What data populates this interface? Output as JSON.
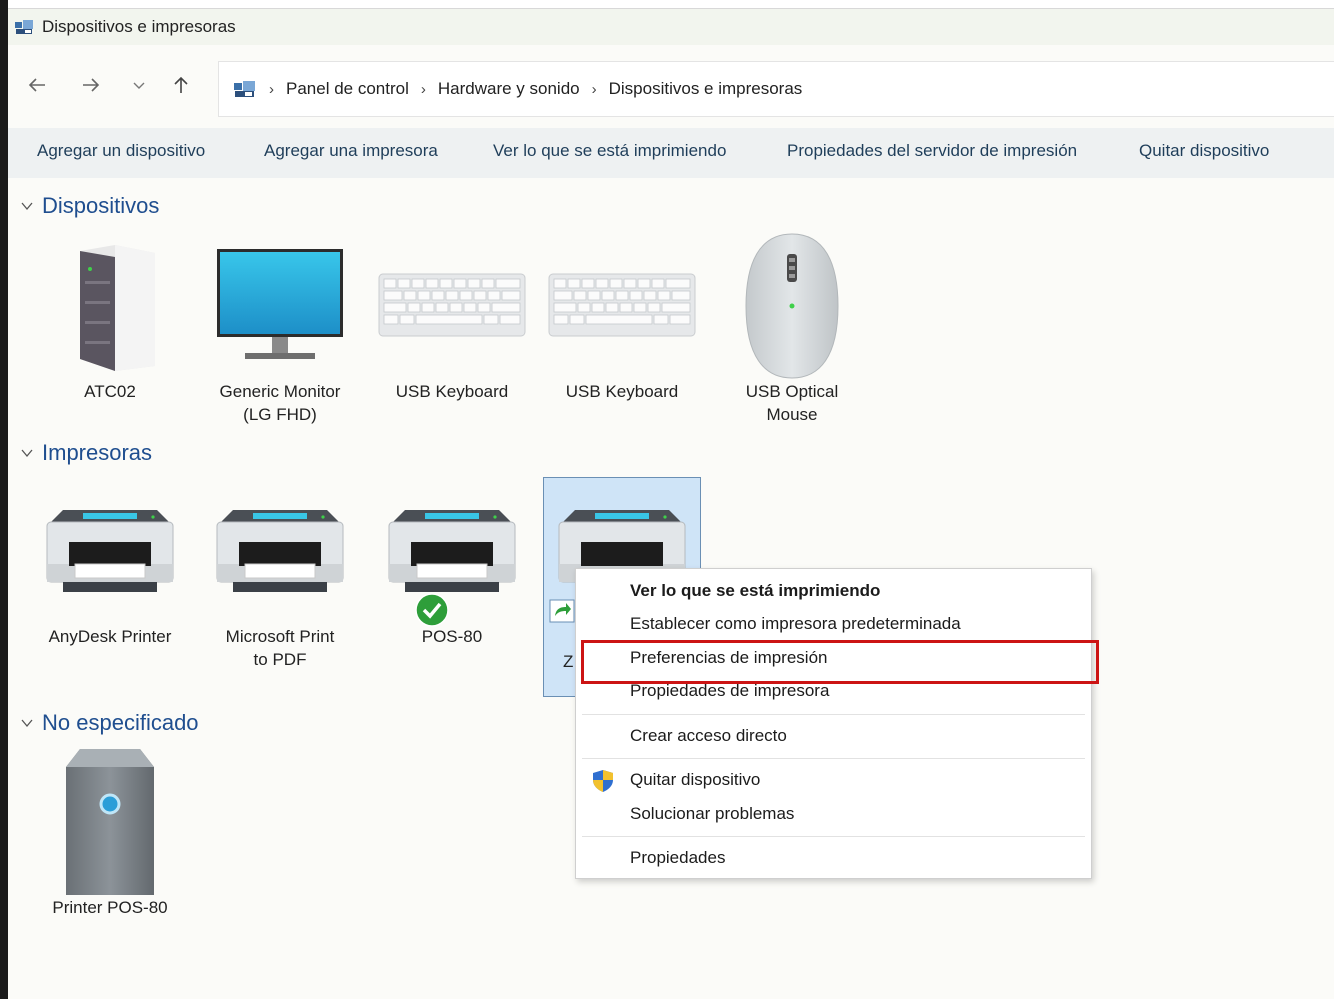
{
  "window": {
    "title": "Dispositivos e impresoras"
  },
  "nav": {
    "back_icon": "arrow-left-icon",
    "forward_icon": "arrow-right-icon",
    "recent_icon": "chevron-down-icon",
    "up_icon": "arrow-up-icon"
  },
  "breadcrumb": [
    {
      "label": "Panel de control"
    },
    {
      "label": "Hardware y sonido"
    },
    {
      "label": "Dispositivos e impresoras"
    }
  ],
  "breadcrumb_separator": "›",
  "toolbar": {
    "add_device": "Agregar un dispositivo",
    "add_printer": "Agregar una impresora",
    "see_printing": "Ver lo que se está imprimiendo",
    "server_props": "Propiedades del servidor de impresión",
    "remove_device": "Quitar dispositivo"
  },
  "groups": {
    "devices": {
      "title": "Dispositivos",
      "items": [
        {
          "label1": "ATC02",
          "label2": "",
          "icon": "computer-tower-icon"
        },
        {
          "label1": "Generic Monitor",
          "label2": "(LG FHD)",
          "icon": "monitor-icon"
        },
        {
          "label1": "USB Keyboard",
          "label2": "",
          "icon": "keyboard-icon"
        },
        {
          "label1": "USB Keyboard",
          "label2": "",
          "icon": "keyboard-icon"
        },
        {
          "label1": "USB Optical",
          "label2": "Mouse",
          "icon": "mouse-icon"
        }
      ]
    },
    "printers": {
      "title": "Impresoras",
      "items": [
        {
          "label1": "AnyDesk Printer",
          "label2": "",
          "icon": "printer-icon"
        },
        {
          "label1": "Microsoft Print",
          "label2": "to PDF",
          "icon": "printer-icon"
        },
        {
          "label1": "POS-80",
          "label2": "",
          "icon": "printer-icon",
          "badge": "default-check-icon"
        },
        {
          "label1": "Z",
          "label2": "",
          "icon": "printer-icon",
          "badge": "shared-arrow-icon",
          "selected": true
        }
      ]
    },
    "unspecified": {
      "title": "No especificado",
      "items": [
        {
          "label1": "Printer POS-80",
          "label2": "",
          "icon": "generic-device-icon"
        }
      ]
    }
  },
  "context_menu": {
    "items": [
      {
        "label": "Ver lo que se está imprimiendo",
        "bold": true
      },
      {
        "label": "Establecer como impresora predeterminada"
      },
      {
        "label": "Preferencias de impresión",
        "highlighted": true
      },
      {
        "label": "Propiedades de impresora"
      },
      {
        "label": "Crear acceso directo"
      },
      {
        "label": "Quitar dispositivo",
        "icon": "uac-shield-icon"
      },
      {
        "label": "Solucionar problemas"
      },
      {
        "label": "Propiedades"
      }
    ]
  },
  "colors": {
    "group_title": "#1f4e8f",
    "toolbar_bg": "#eef1f2",
    "selection": "#cfe4f7",
    "highlight_box": "#cc1414"
  }
}
